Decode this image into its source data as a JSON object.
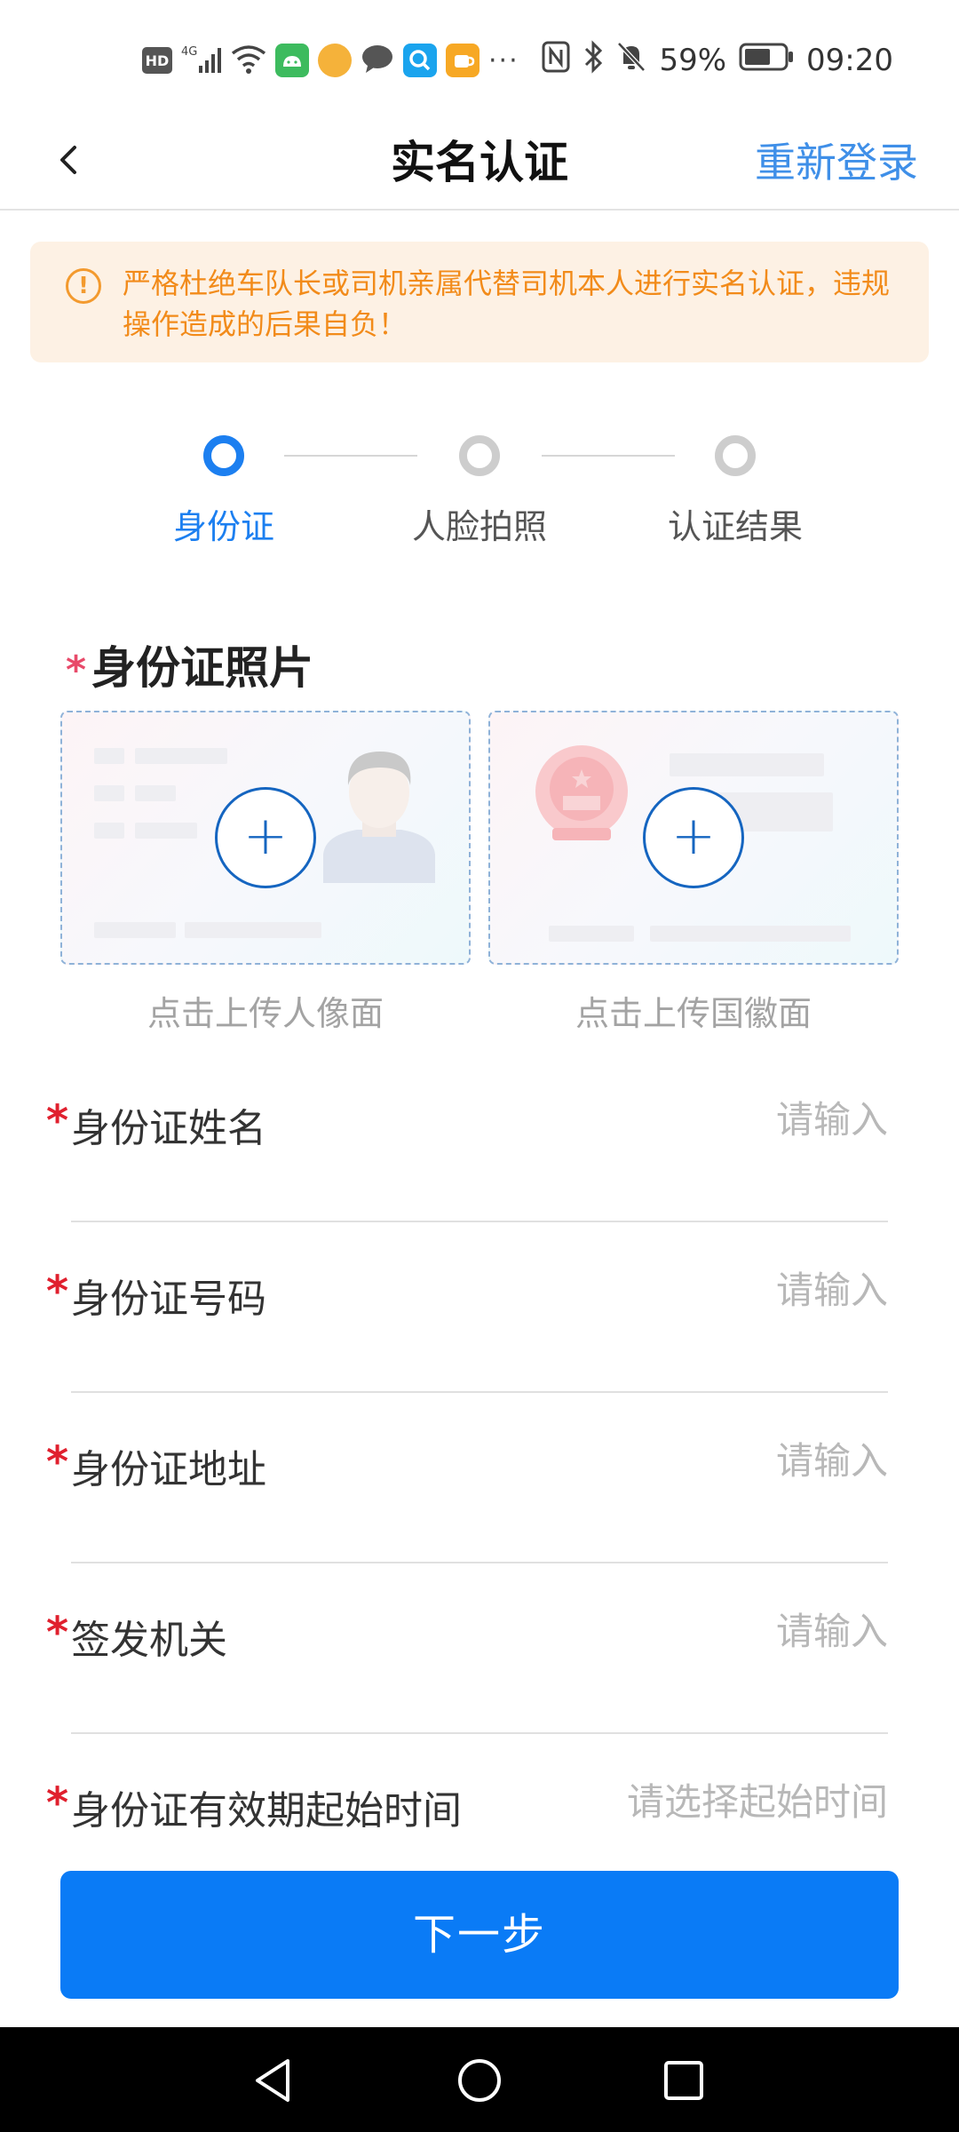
{
  "status_bar": {
    "battery_percent": "59%",
    "time": "09:20",
    "hd_label": "HD",
    "network_label": "4G",
    "more_indicator": "···",
    "icons": [
      "hd-icon",
      "signal-icon",
      "wifi-icon",
      "android-icon",
      "app-icon",
      "chat-icon",
      "search-app-icon",
      "app-icon",
      "nfc-icon",
      "bluetooth-icon",
      "bell-muted-icon",
      "battery-icon"
    ]
  },
  "header": {
    "title": "实名认证",
    "relogin": "重新登录"
  },
  "warning": {
    "text": "严格杜绝车队长或司机亲属代替司机本人进行实名认证，违规操作造成的后果自负！"
  },
  "stepper": {
    "steps": [
      {
        "label": "身份证",
        "active": true
      },
      {
        "label": "人脸拍照",
        "active": false
      },
      {
        "label": "认证结果",
        "active": false
      }
    ]
  },
  "id_photos": {
    "title": "身份证照片",
    "required_mark": "*",
    "front_caption": "点击上传人像面",
    "back_caption": "点击上传国徽面",
    "plus": "+"
  },
  "form": {
    "required_mark": "*",
    "fields": [
      {
        "label": "身份证姓名",
        "placeholder": "请输入",
        "value": ""
      },
      {
        "label": "身份证号码",
        "placeholder": "请输入",
        "value": ""
      },
      {
        "label": "身份证地址",
        "placeholder": "请输入",
        "value": ""
      },
      {
        "label": "签发机关",
        "placeholder": "请输入",
        "value": ""
      },
      {
        "label": "身份证有效期起始时间",
        "placeholder": "请选择起始时间",
        "value": ""
      }
    ]
  },
  "next_button": "下一步",
  "colors": {
    "primary": "#0a7bf6",
    "step_active": "#1c7ff0",
    "warning_bg": "#fdf1e4",
    "warning_text": "#f28b1a",
    "required": "#e0202e"
  }
}
